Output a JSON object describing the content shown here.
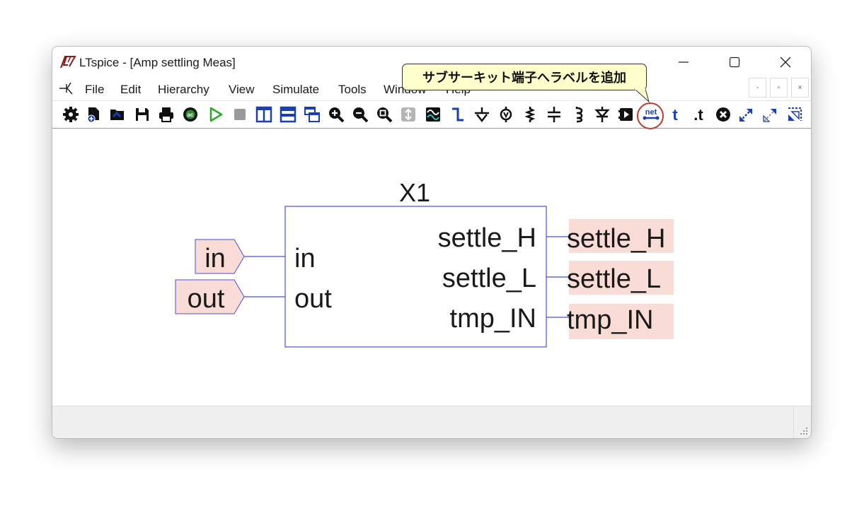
{
  "window": {
    "title": "LTspice - [Amp settling Meas]",
    "minimize_glyph": "—",
    "maximize_glyph": "☐",
    "close_glyph": "✕"
  },
  "menu": {
    "items": [
      "File",
      "Edit",
      "Hierarchy",
      "View",
      "Simulate",
      "Tools",
      "Window",
      "Help"
    ]
  },
  "mdi_controls": [
    "-",
    "▫",
    "×"
  ],
  "toolbar": {
    "icons": [
      "gear-icon",
      "new-schematic-icon",
      "open-icon",
      "save-icon",
      "print-icon",
      "ac-analysis-icon",
      "run-icon",
      "halt-icon",
      "vertical-split-icon",
      "horizontal-split-icon",
      "cascade-icon",
      "zoom-in-icon",
      "zoom-out-icon",
      "zoom-fit-icon",
      "autorange-icon",
      "waveform-icon",
      "wire-icon",
      "ground-icon",
      "voltage-source-icon",
      "resistor-icon",
      "capacitor-icon",
      "inductor-icon",
      "diode-icon",
      "component-icon",
      "net-label-icon",
      "text-icon",
      "spice-directive-icon",
      "delete-icon",
      "move-icon",
      "drag-icon",
      "mirror-icon"
    ],
    "net_label": "net",
    "text_t": "t",
    "directive_t": ".t",
    "highlight_color": "#c0392b"
  },
  "tooltip": {
    "text": "サブサーキット端子へラベルを追加"
  },
  "schematic": {
    "instance_name": "X1",
    "left_pins": [
      "in",
      "out"
    ],
    "right_pins": [
      "settle_H",
      "settle_L",
      "tmp_IN"
    ],
    "input_labels": [
      "in",
      "out"
    ],
    "output_labels": [
      "settle_H",
      "settle_L",
      "tmp_IN"
    ],
    "label_fill": "#f9dcd5",
    "wire_color": "#4a4fd0"
  }
}
